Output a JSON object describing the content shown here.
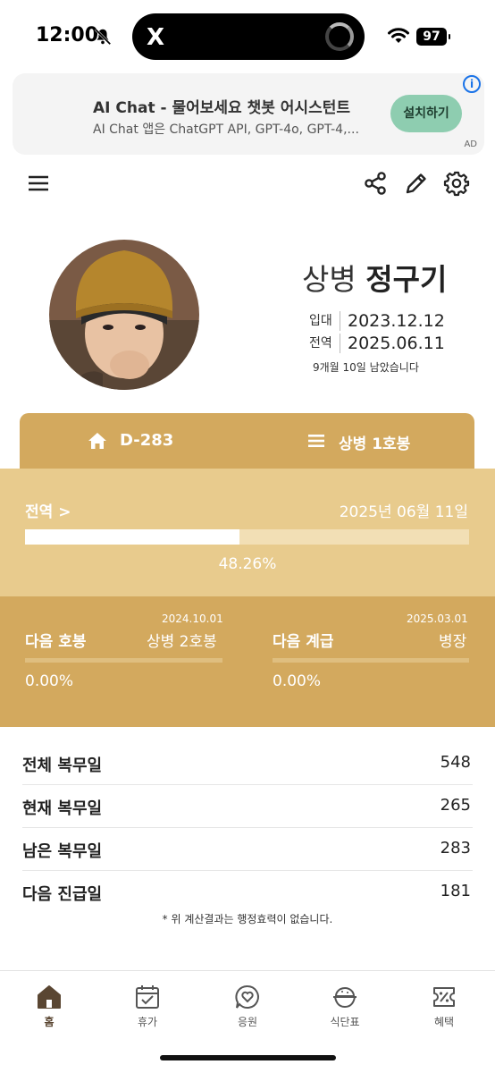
{
  "status_bar": {
    "time": "12:00",
    "battery": "97",
    "island_app": "X"
  },
  "ad": {
    "title": "AI Chat - 물어보세요 챗봇 어시스턴트",
    "description": "AI Chat 앱은 ChatGPT API, GPT-4o, GPT-4,...",
    "button": "설치하기",
    "info": "i",
    "label": "AD"
  },
  "toolbar": {
    "icons": [
      "menu-icon",
      "share-icon",
      "edit-icon",
      "settings-icon"
    ]
  },
  "profile": {
    "rank": "상병",
    "name": "정구기",
    "enlist_label": "입대",
    "enlist_date": "2023.12.12",
    "discharge_label": "전역",
    "discharge_date": "2025.06.11",
    "remaining": "9개월 10일 남았습니다"
  },
  "info_bar": {
    "dday": "D-283",
    "grade": "상병 1호봉"
  },
  "discharge": {
    "label": "전역 >",
    "date": "2025년 06월 11일",
    "percent_text": "48.26%",
    "percent": 48.26
  },
  "next_step": {
    "label": "다음 호봉",
    "date": "2024.10.01",
    "value": "상병 2호봉",
    "percent_text": "0.00%",
    "percent": 0
  },
  "next_rank": {
    "label": "다음 계급",
    "date": "2025.03.01",
    "value": "병장",
    "percent_text": "0.00%",
    "percent": 0
  },
  "stats": [
    {
      "label": "전체 복무일",
      "value": "548"
    },
    {
      "label": "현재 복무일",
      "value": "265"
    },
    {
      "label": "남은 복무일",
      "value": "283"
    },
    {
      "label": "다음 진급일",
      "value": "181"
    }
  ],
  "note": "* 위 계산결과는 행정효력이 없습니다.",
  "nav": [
    {
      "label": "홈",
      "icon": "home-icon"
    },
    {
      "label": "휴가",
      "icon": "calendar-check-icon"
    },
    {
      "label": "응원",
      "icon": "heart-chat-icon"
    },
    {
      "label": "식단표",
      "icon": "rice-bowl-icon"
    },
    {
      "label": "혜택",
      "icon": "ticket-icon"
    }
  ],
  "colors": {
    "gold": "#d3a95e",
    "light_gold": "#e8cb8d",
    "ad_button": "#8ecdb0",
    "nav_active": "#5a4632"
  }
}
